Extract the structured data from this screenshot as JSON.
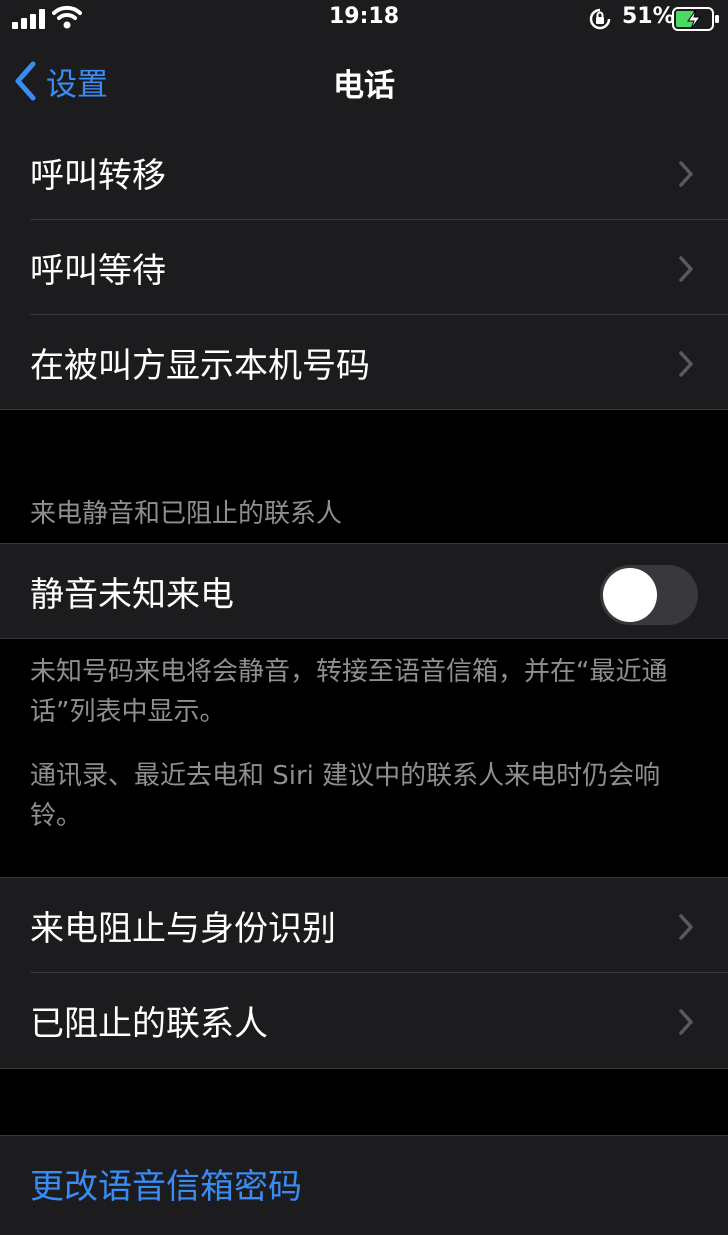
{
  "status_bar": {
    "time": "19:18",
    "battery_percent": "51%"
  },
  "nav": {
    "back_label": "设置",
    "title": "电话"
  },
  "group1": {
    "items": [
      {
        "label": "呼叫转移"
      },
      {
        "label": "呼叫等待"
      },
      {
        "label": "在被叫方显示本机号码"
      }
    ]
  },
  "silence_section": {
    "header": "来电静音和已阻止的联系人",
    "toggle_label": "静音未知来电",
    "toggle_on": false,
    "footer_1": "未知号码来电将会静音，转接至语音信箱，并在“最近通话”列表中显示。",
    "footer_2": "通讯录、最近去电和 Siri 建议中的联系人来电时仍会响铃。"
  },
  "group2": {
    "items": [
      {
        "label": "来电阻止与身份识别"
      },
      {
        "label": "已阻止的联系人"
      }
    ]
  },
  "voicemail": {
    "label": "更改语音信箱密码"
  },
  "colors": {
    "accent": "#3a8cf5",
    "cell_bg": "#1c1c1e",
    "page_bg": "#000000",
    "secondary_text": "#8e8e93"
  }
}
